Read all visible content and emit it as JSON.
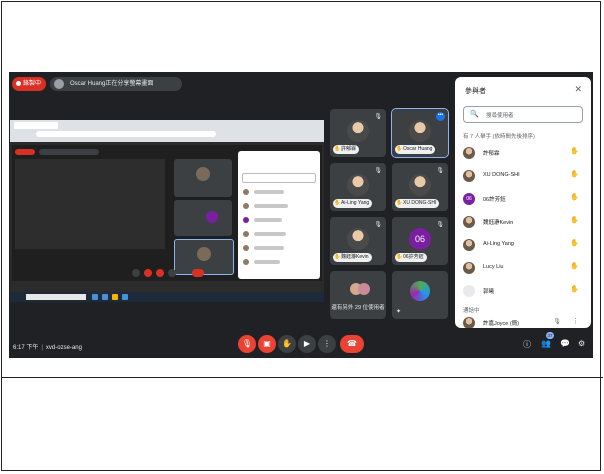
{
  "meeting": {
    "recording_label": "錄製中",
    "presenter_banner": "Oscar Huang正在分享螢幕畫面",
    "meeting_code": "xvd-ozse-ang",
    "time": "6:17 下午"
  },
  "tiles": [
    {
      "name": "許郁霖"
    },
    {
      "name": "Oscar Huang"
    },
    {
      "name": "Ai-Ling Yang"
    },
    {
      "name": "XU DONG-SHI"
    },
    {
      "name": "魏鈺瀞Kevin"
    },
    {
      "name": "06許芳鈺",
      "initial": "06"
    },
    {
      "others": "還有另外 29 位使用者"
    },
    {}
  ],
  "people_panel": {
    "title": "參與者",
    "search_placeholder": "搜尋使用者",
    "section_raised": "有 7 人舉手 (依時間先後排序)",
    "section_in_call": "通話中",
    "participants": [
      {
        "name": "許郁霖"
      },
      {
        "name": "XU DONG-SHI"
      },
      {
        "name": "06許芳鈺",
        "initial": "06"
      },
      {
        "name": "魏鈺瀞Kevin"
      },
      {
        "name": "Ai-Ling Yang"
      },
      {
        "name": "Lucy Liu"
      },
      {
        "name": "郭曦"
      },
      {
        "name": "許嘉Joyce (簡)"
      }
    ],
    "participant_count": "37"
  },
  "icons": {
    "mic": "mic-off-icon",
    "camera": "camera-off-icon",
    "hand": "raise-hand-icon",
    "present": "present-icon",
    "more": "more-options-icon",
    "end": "end-call-icon",
    "info": "info-icon",
    "people": "people-icon",
    "chat": "chat-icon",
    "activities": "activities-icon"
  },
  "colors": {
    "background": "#202124",
    "danger": "#ea4335",
    "accent": "#8ab4f8",
    "tile": "#3c4043"
  }
}
